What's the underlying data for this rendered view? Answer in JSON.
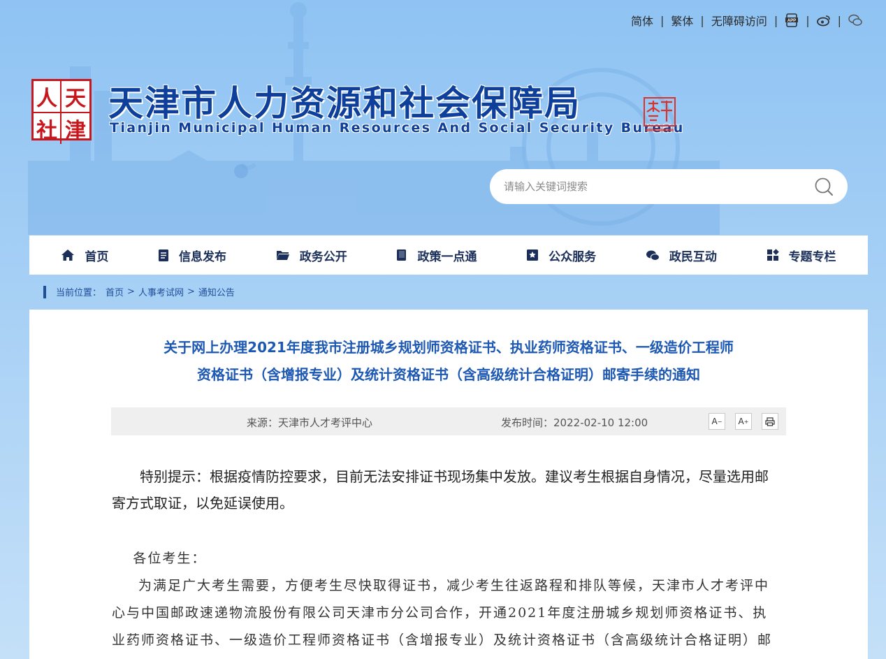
{
  "top_links": {
    "simplified": "简体",
    "traditional": "繁体",
    "accessible": "无障碍访问",
    "app_icon": "app-icon",
    "weibo_icon": "weibo-icon",
    "wechat_icon": "wechat-icon"
  },
  "header": {
    "logo_chars": [
      "天",
      "人",
      "津",
      "社"
    ],
    "title": "天津市人力资源和社会保障局",
    "subtitle": "Tianjin Municipal Human Resources And Social Security Bureau",
    "stamp_icon": "tianjin-stamp-icon"
  },
  "search": {
    "placeholder": "请输入关键词搜索",
    "value": ""
  },
  "nav": {
    "items": [
      {
        "label": "首页",
        "icon": "home-icon"
      },
      {
        "label": "信息发布",
        "icon": "info-icon"
      },
      {
        "label": "政务公开",
        "icon": "folder-icon"
      },
      {
        "label": "政策一点通",
        "icon": "book-icon"
      },
      {
        "label": "公众服务",
        "icon": "service-icon"
      },
      {
        "label": "政民互动",
        "icon": "chat-icon"
      },
      {
        "label": "专题专栏",
        "icon": "grid-icon"
      }
    ]
  },
  "breadcrumb": {
    "prefix": "当前位置：",
    "items": [
      "首页",
      "人事考试网",
      "通知公告"
    ],
    "separator": ">"
  },
  "article": {
    "title_line1": "关于网上办理2021年度我市注册城乡规划师资格证书、执业药师资格证书、一级造价工程师",
    "title_line2": "资格证书（含增报专业）及统计资格证书（含高级统计合格证明）邮寄手续的通知",
    "source_label": "来源：",
    "source": "天津市人才考评中心",
    "time_label": "发布时间：",
    "time": "2022-02-10 12:00",
    "font_smaller": "A",
    "font_larger": "A",
    "tip": "特别提示：根据疫情防控要求，目前无法安排证书现场集中发放。建议考生根据自身情况，尽量选用邮寄方式取证，以免延误使用。",
    "greeting": "各位考生：",
    "body": "为满足广大考生需要，方便考生尽快取得证书，减少考生往返路程和排队等候，天津市人才考评中心与中国邮政速递物流股份有限公司天津市分公司合作，开通2021年度注册城乡规划师资格证书、执业药师资格证书、一级造价工程师资格证书（含增报专业）及统计资格证书（含高级统计合格证明）邮政"
  },
  "colors": {
    "brand_blue": "#0e3f9a",
    "title_blue": "#1d58b3",
    "seal_red": "#c8161d"
  }
}
